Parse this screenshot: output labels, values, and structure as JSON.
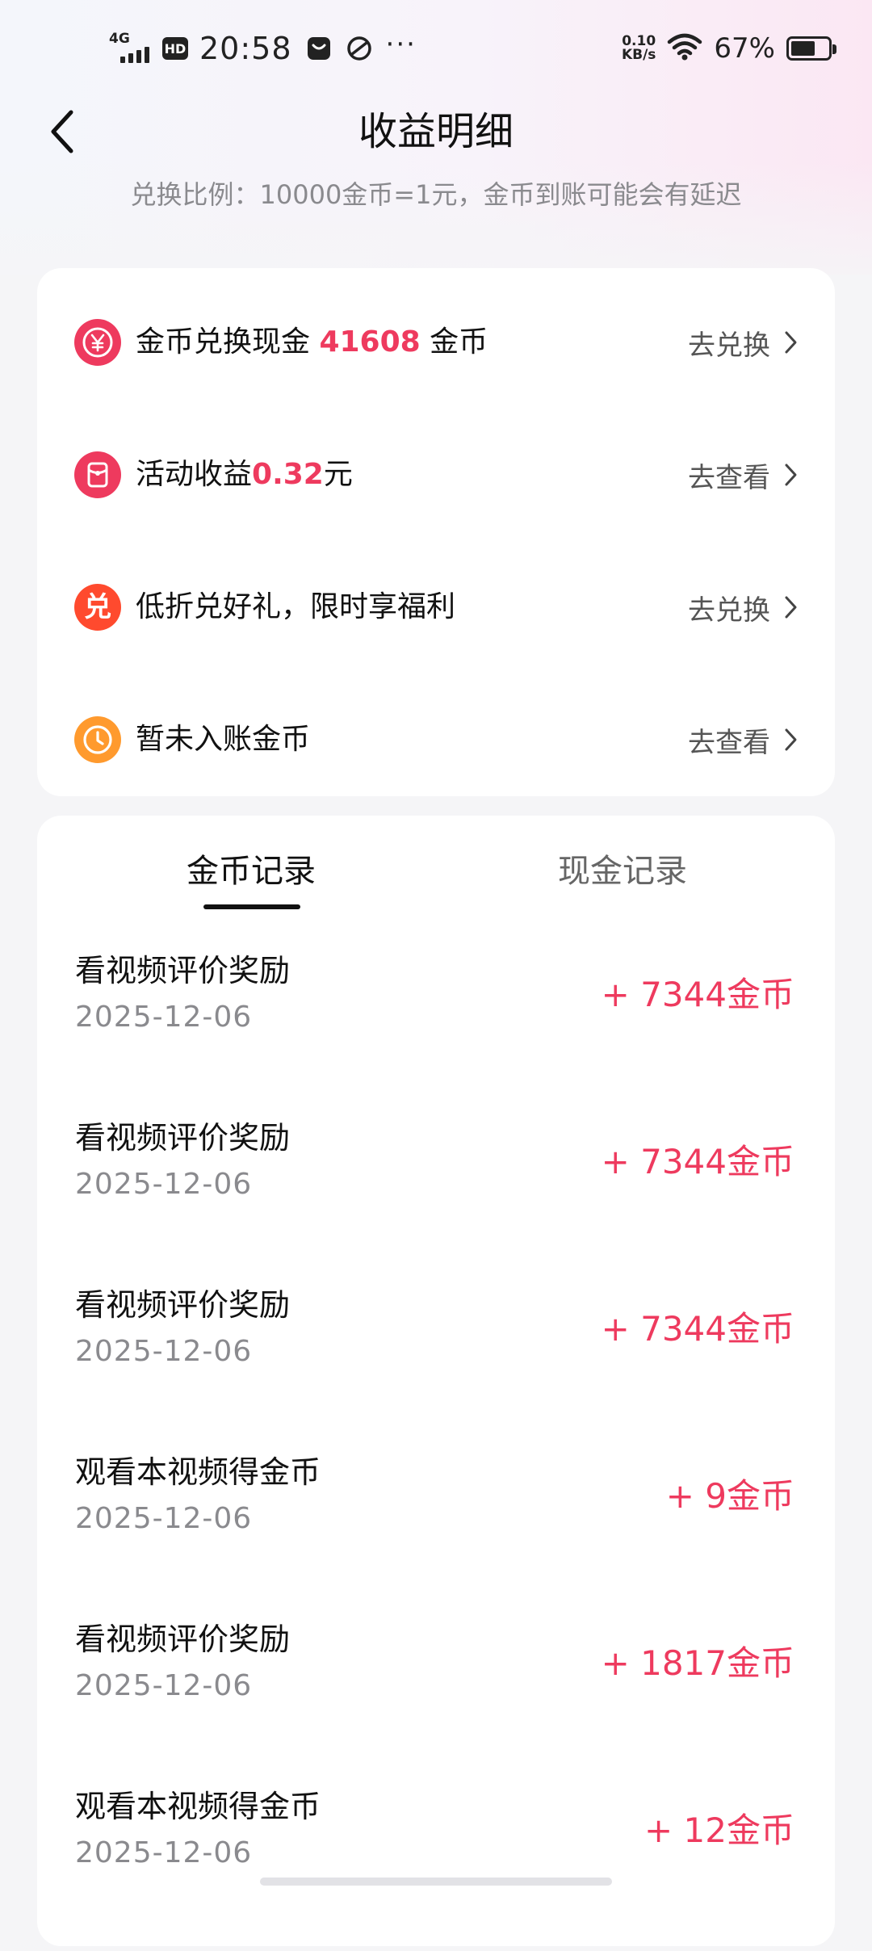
{
  "status_bar": {
    "network": "4G",
    "hd": "HD",
    "time": "20:58",
    "speed_value": "0.10",
    "speed_unit": "KB/s",
    "battery_pct": "67%",
    "battery_level": 0.67
  },
  "header": {
    "title": "收益明细",
    "subtitle": "兑换比例：10000金币=1元，金币到账可能会有延迟"
  },
  "actions": [
    {
      "icon": "yuan-coin-icon",
      "label_prefix": "金币兑换现金 ",
      "label_value": "41608",
      "label_suffix": " 金币",
      "link": "去兑换",
      "color": "#ee3a5e"
    },
    {
      "icon": "red-envelope-icon",
      "label_prefix": "活动收益",
      "label_value": "0.32",
      "label_suffix": "元",
      "link": "去查看",
      "color": "#ee3a5e"
    },
    {
      "icon": "exchange-badge-icon",
      "icon_text": "兑",
      "label_prefix": "低折兑好礼，限时享福利",
      "label_value": "",
      "label_suffix": "",
      "link": "去兑换",
      "color": "#ff4a2e"
    },
    {
      "icon": "clock-icon",
      "label_prefix": "暂未入账金币",
      "label_value": "",
      "label_suffix": "",
      "link": "去查看",
      "color": "#ff9a2e"
    }
  ],
  "tabs": {
    "coin": "金币记录",
    "cash": "现金记录",
    "active": "coin"
  },
  "records": [
    {
      "title": "看视频评价奖励",
      "date": "2025-12-06",
      "amount": "+ 7344金币"
    },
    {
      "title": "看视频评价奖励",
      "date": "2025-12-06",
      "amount": "+ 7344金币"
    },
    {
      "title": "看视频评价奖励",
      "date": "2025-12-06",
      "amount": "+ 7344金币"
    },
    {
      "title": "观看本视频得金币",
      "date": "2025-12-06",
      "amount": "+ 9金币"
    },
    {
      "title": "看视频评价奖励",
      "date": "2025-12-06",
      "amount": "+ 1817金币"
    },
    {
      "title": "观看本视频得金币",
      "date": "2025-12-06",
      "amount": "+ 12金币"
    }
  ],
  "colors": {
    "accent": "#ee3a5e",
    "text_primary": "#111111",
    "text_secondary": "#8a8a8e"
  }
}
